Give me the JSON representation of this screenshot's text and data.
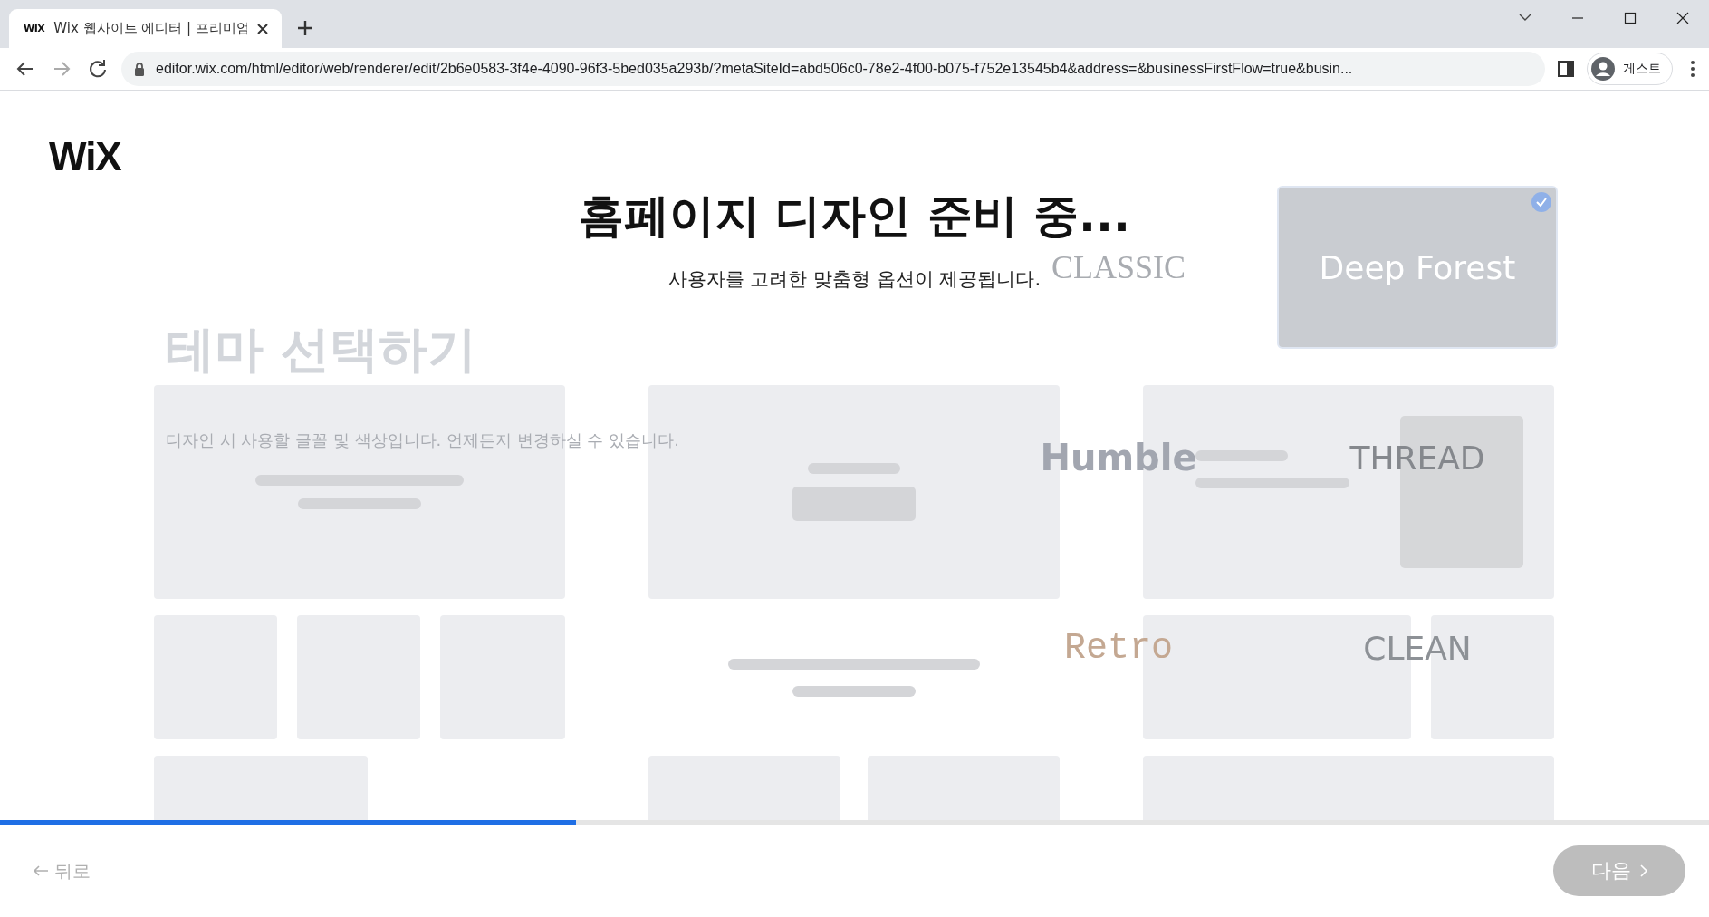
{
  "browser": {
    "tab_title": "Wix 웹사이트 에디터 | 프리미엄",
    "tab_favicon": "WIX",
    "url": "editor.wix.com/html/editor/web/renderer/edit/2b6e0583-3f4e-4090-96f3-5bed035a293b/?metaSiteId=abd506c0-78e2-4f00-b075-f752e13545b4&address=&businessFirstFlow=true&busin...",
    "profile_label": "게스트"
  },
  "logo": "WiX",
  "loading": {
    "title": "홈페이지 디자인 준비 중...",
    "subtitle": "사용자를 고려한 맞춤형 옵션이 제공됩니다.",
    "level": 0.337
  },
  "theme_picker": {
    "heading": "테마 선택하기",
    "description": "디자인 시 사용할 글꼴 및 색상입니다. 언제든지 변경하실 수 있습니다.",
    "themes": [
      {
        "name": "CLASSIC",
        "kind": "classic",
        "selected": false
      },
      {
        "name": "Deep Forest",
        "kind": "forest",
        "selected": true
      },
      {
        "name": "Humble",
        "kind": "humble",
        "selected": false
      },
      {
        "name": "THREAD",
        "kind": "thread",
        "selected": false
      },
      {
        "name": "Retro",
        "kind": "retro",
        "selected": false
      },
      {
        "name": "CLEAN",
        "kind": "clean",
        "selected": false
      }
    ]
  },
  "footer": {
    "back": "뒤로",
    "next": "다음"
  }
}
